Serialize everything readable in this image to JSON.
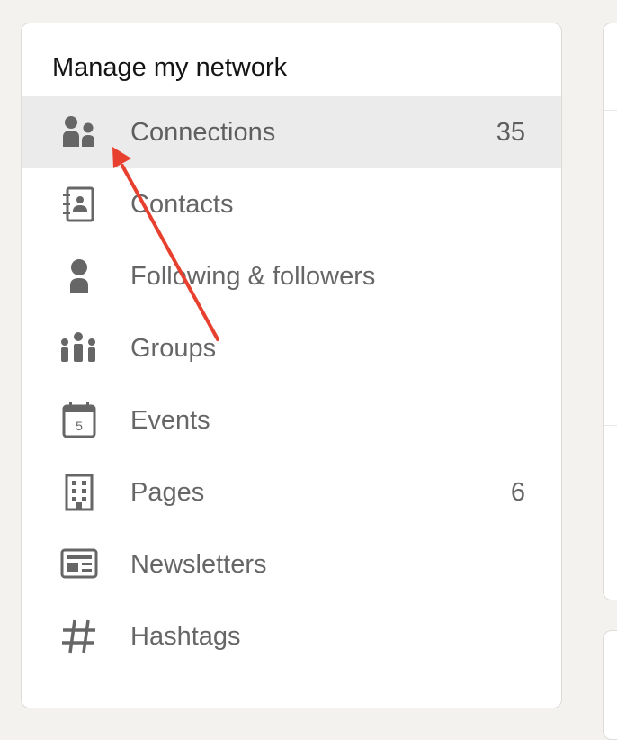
{
  "panel": {
    "title": "Manage my network",
    "items": [
      {
        "name": "connections",
        "label": "Connections",
        "count": "35",
        "icon": "people-icon",
        "active": true
      },
      {
        "name": "contacts",
        "label": "Contacts",
        "count": "",
        "icon": "address-book-icon"
      },
      {
        "name": "following",
        "label": "Following & followers",
        "count": "",
        "icon": "person-icon"
      },
      {
        "name": "groups",
        "label": "Groups",
        "count": "",
        "icon": "group-icon"
      },
      {
        "name": "events",
        "label": "Events",
        "count": "",
        "icon": "calendar-icon",
        "icon_text": "5"
      },
      {
        "name": "pages",
        "label": "Pages",
        "count": "6",
        "icon": "building-icon"
      },
      {
        "name": "newsletters",
        "label": "Newsletters",
        "count": "",
        "icon": "newsletter-icon"
      },
      {
        "name": "hashtags",
        "label": "Hashtags",
        "count": "",
        "icon": "hashtag-icon"
      }
    ]
  },
  "colors": {
    "page_bg": "#f4f2ee",
    "panel_bg": "#ffffff",
    "active_row": "#ebebeb",
    "icon": "#666666",
    "annotation_arrow": "#e8402f"
  }
}
